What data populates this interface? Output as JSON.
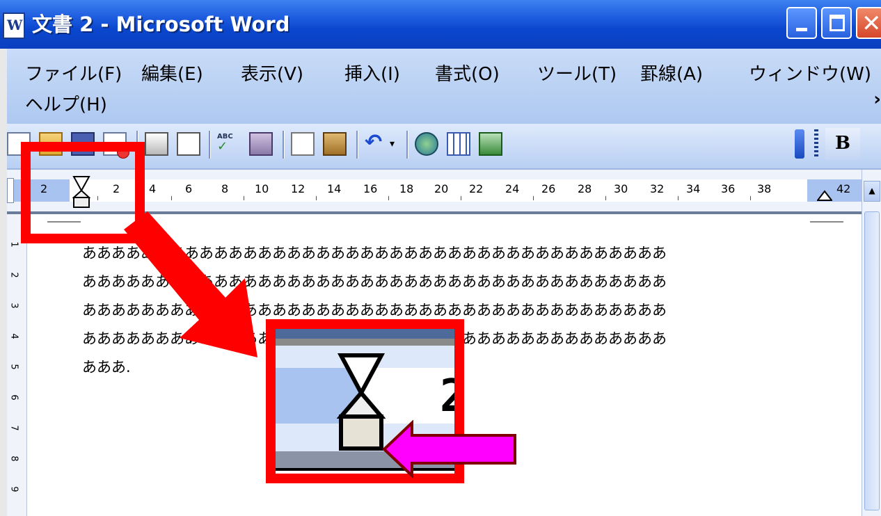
{
  "window": {
    "title": "文書 2 - Microsoft Word",
    "title_icon": "word-document-icon",
    "controls": {
      "minimize": "minimize-icon",
      "maximize": "maximize-icon",
      "close": "close-icon"
    }
  },
  "menu": {
    "items": [
      "ファイル(F)",
      "編集(E)",
      "表示(V)",
      "挿入(I)",
      "書式(O)",
      "ツール(T)",
      "罫線(A)",
      "ウィンドウ(W)",
      "ヘルプ(H)"
    ],
    "overflow": "›"
  },
  "toolbar": {
    "icons": [
      "new-document-icon",
      "open-folder-icon",
      "save-icon",
      "permission-icon",
      "print-icon",
      "print-preview-icon",
      "spelling-icon",
      "research-icon",
      "copy-icon",
      "paste-icon",
      "undo-icon",
      "undo-dropdown-icon",
      "hyperlink-icon",
      "insert-table-icon",
      "insert-excel-icon",
      "toolbar-options-icon"
    ],
    "bold_label": "B"
  },
  "ruler": {
    "numbers": [
      "2",
      "2",
      "4",
      "6",
      "8",
      "10",
      "12",
      "14",
      "16",
      "18",
      "20",
      "22",
      "24",
      "26",
      "28",
      "30",
      "32",
      "34",
      "36",
      "38",
      "42"
    ]
  },
  "vertical_ruler": {
    "numbers": [
      "1",
      "2",
      "3",
      "4",
      "5",
      "6",
      "7",
      "8",
      "9"
    ]
  },
  "document": {
    "lines": [
      "ああああああああああああああああああああああああああああああああああああああああ",
      "ああああああああああああああああああああああああああああああああああああああああ",
      "ああああああああああああああああああああああああああああああああああああああああ",
      "ああああああああああああああああああああああああああああああああああああああああ",
      "あああ."
    ]
  },
  "annotations": {
    "highlight_color": "#ff0000",
    "arrow_color": "#ff0000",
    "pointer_color": "#ff00ff",
    "zoom_digit": "2"
  }
}
